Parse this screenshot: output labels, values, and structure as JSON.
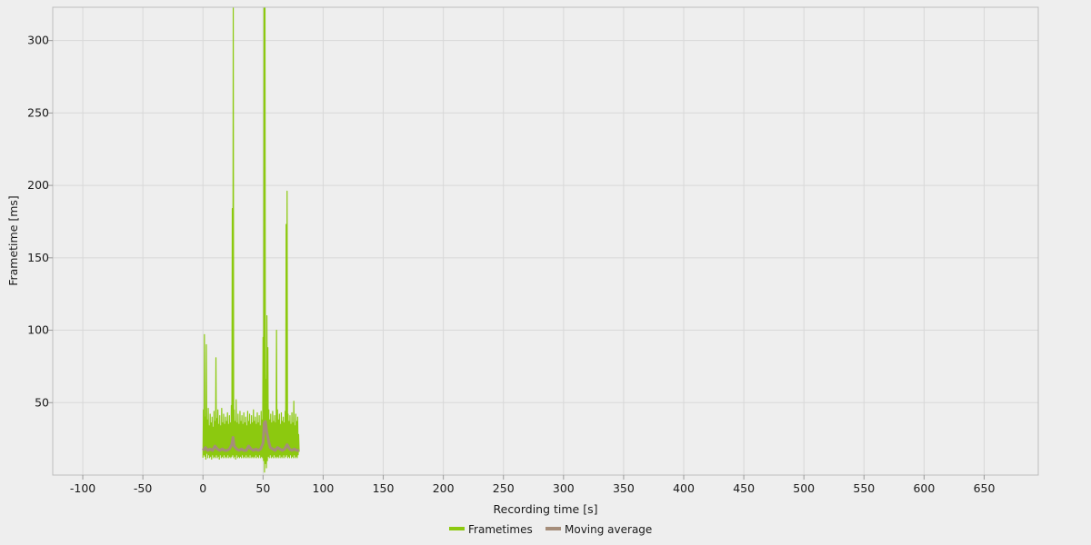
{
  "chart_data": {
    "type": "line",
    "title": "",
    "xlabel": "Recording time [s]",
    "ylabel": "Frametime [ms]",
    "xlim": [
      -125,
      695
    ],
    "ylim": [
      0,
      323
    ],
    "x_ticks": [
      -100,
      -50,
      0,
      50,
      100,
      150,
      200,
      250,
      300,
      350,
      400,
      450,
      500,
      550,
      600,
      650
    ],
    "x_tick_labels": [
      "-100",
      "-50",
      "0",
      "50",
      "100",
      "150",
      "200",
      "250",
      "300",
      "350",
      "400",
      "450",
      "500",
      "550",
      "600",
      "650"
    ],
    "y_ticks": [
      50,
      100,
      150,
      200,
      250,
      300
    ],
    "y_tick_labels": [
      "50",
      "100",
      "150",
      "200",
      "250",
      "300"
    ],
    "grid": true,
    "legend_position": "bottom-center",
    "series": [
      {
        "name": "Frametimes",
        "color": "#8cc90f",
        "points": [
          [
            0,
            12
          ],
          [
            0.4,
            45
          ],
          [
            0.8,
            14
          ],
          [
            1.2,
            97
          ],
          [
            1.6,
            13
          ],
          [
            2.0,
            40
          ],
          [
            2.4,
            11
          ],
          [
            2.8,
            90
          ],
          [
            3.2,
            15
          ],
          [
            3.6,
            38
          ],
          [
            4.0,
            12
          ],
          [
            4.4,
            46
          ],
          [
            4.8,
            14
          ],
          [
            5.2,
            34
          ],
          [
            5.6,
            12
          ],
          [
            6.0,
            42
          ],
          [
            6.4,
            13
          ],
          [
            6.8,
            36
          ],
          [
            7.2,
            11
          ],
          [
            7.6,
            40
          ],
          [
            8.0,
            14
          ],
          [
            8.4,
            33
          ],
          [
            8.8,
            12
          ],
          [
            9.2,
            44
          ],
          [
            9.6,
            13
          ],
          [
            10.0,
            37
          ],
          [
            10.4,
            12
          ],
          [
            10.8,
            81
          ],
          [
            11.2,
            14
          ],
          [
            11.6,
            39
          ],
          [
            12.0,
            12
          ],
          [
            12.4,
            45
          ],
          [
            12.8,
            13
          ],
          [
            13.2,
            35
          ],
          [
            13.6,
            11
          ],
          [
            14.0,
            41
          ],
          [
            14.4,
            14
          ],
          [
            14.8,
            34
          ],
          [
            15.2,
            12
          ],
          [
            15.6,
            46
          ],
          [
            16.0,
            13
          ],
          [
            16.4,
            36
          ],
          [
            16.8,
            12
          ],
          [
            17.2,
            42
          ],
          [
            17.6,
            14
          ],
          [
            18.0,
            35
          ],
          [
            18.4,
            12
          ],
          [
            18.8,
            40
          ],
          [
            19.2,
            13
          ],
          [
            19.6,
            37
          ],
          [
            20.0,
            12
          ],
          [
            20.4,
            43
          ],
          [
            20.8,
            14
          ],
          [
            21.2,
            35
          ],
          [
            21.6,
            12
          ],
          [
            22.0,
            41
          ],
          [
            22.4,
            13
          ],
          [
            22.8,
            36
          ],
          [
            23.2,
            12
          ],
          [
            23.6,
            48
          ],
          [
            24.0,
            13
          ],
          [
            24.4,
            184
          ],
          [
            24.8,
            14
          ],
          [
            25.2,
            323
          ],
          [
            25.6,
            12
          ],
          [
            26.0,
            45
          ],
          [
            26.4,
            13
          ],
          [
            26.8,
            37
          ],
          [
            27.2,
            11
          ],
          [
            27.6,
            52
          ],
          [
            28.0,
            14
          ],
          [
            28.4,
            36
          ],
          [
            28.8,
            12
          ],
          [
            29.2,
            42
          ],
          [
            29.6,
            13
          ],
          [
            30.0,
            35
          ],
          [
            30.4,
            12
          ],
          [
            30.8,
            44
          ],
          [
            31.2,
            13
          ],
          [
            31.6,
            37
          ],
          [
            32.0,
            12
          ],
          [
            32.4,
            41
          ],
          [
            32.8,
            14
          ],
          [
            33.2,
            35
          ],
          [
            33.6,
            12
          ],
          [
            34.0,
            43
          ],
          [
            34.4,
            13
          ],
          [
            34.8,
            36
          ],
          [
            35.2,
            12
          ],
          [
            35.6,
            40
          ],
          [
            36.0,
            14
          ],
          [
            36.4,
            34
          ],
          [
            36.8,
            12
          ],
          [
            37.2,
            44
          ],
          [
            37.6,
            13
          ],
          [
            38.0,
            37
          ],
          [
            38.4,
            12
          ],
          [
            38.8,
            42
          ],
          [
            39.2,
            14
          ],
          [
            39.6,
            35
          ],
          [
            40.0,
            12
          ],
          [
            40.4,
            41
          ],
          [
            40.8,
            13
          ],
          [
            41.2,
            36
          ],
          [
            41.6,
            12
          ],
          [
            42.0,
            45
          ],
          [
            42.4,
            13
          ],
          [
            42.8,
            37
          ],
          [
            43.2,
            12
          ],
          [
            43.6,
            40
          ],
          [
            44.0,
            14
          ],
          [
            44.4,
            35
          ],
          [
            44.8,
            12
          ],
          [
            45.2,
            43
          ],
          [
            45.6,
            13
          ],
          [
            46.0,
            36
          ],
          [
            46.4,
            12
          ],
          [
            46.8,
            41
          ],
          [
            47.2,
            14
          ],
          [
            47.6,
            34
          ],
          [
            48.0,
            12
          ],
          [
            48.4,
            44
          ],
          [
            48.8,
            13
          ],
          [
            49.2,
            38
          ],
          [
            49.6,
            12
          ],
          [
            50.0,
            95
          ],
          [
            50.4,
            10
          ],
          [
            50.8,
            323
          ],
          [
            51.2,
            2
          ],
          [
            51.6,
            323
          ],
          [
            52.0,
            8
          ],
          [
            52.4,
            66
          ],
          [
            52.8,
            5
          ],
          [
            53.2,
            110
          ],
          [
            53.6,
            10
          ],
          [
            54.0,
            88
          ],
          [
            54.4,
            13
          ],
          [
            54.8,
            45
          ],
          [
            55.2,
            12
          ],
          [
            55.6,
            38
          ],
          [
            56.0,
            14
          ],
          [
            56.4,
            42
          ],
          [
            56.8,
            12
          ],
          [
            57.2,
            36
          ],
          [
            57.6,
            13
          ],
          [
            58.0,
            44
          ],
          [
            58.4,
            12
          ],
          [
            58.8,
            37
          ],
          [
            59.2,
            14
          ],
          [
            59.6,
            41
          ],
          [
            60.0,
            12
          ],
          [
            60.4,
            36
          ],
          [
            60.8,
            13
          ],
          [
            61.2,
            100
          ],
          [
            61.6,
            12
          ],
          [
            62.0,
            45
          ],
          [
            62.4,
            13
          ],
          [
            62.8,
            38
          ],
          [
            63.2,
            12
          ],
          [
            63.6,
            42
          ],
          [
            64.0,
            14
          ],
          [
            64.4,
            35
          ],
          [
            64.8,
            12
          ],
          [
            65.2,
            43
          ],
          [
            65.6,
            13
          ],
          [
            66.0,
            37
          ],
          [
            66.4,
            12
          ],
          [
            66.8,
            40
          ],
          [
            67.2,
            14
          ],
          [
            67.6,
            36
          ],
          [
            68.0,
            12
          ],
          [
            68.4,
            44
          ],
          [
            68.8,
            13
          ],
          [
            69.2,
            173
          ],
          [
            69.6,
            14
          ],
          [
            70.0,
            196
          ],
          [
            70.4,
            12
          ],
          [
            70.8,
            42
          ],
          [
            71.2,
            13
          ],
          [
            71.6,
            37
          ],
          [
            72.0,
            12
          ],
          [
            72.4,
            41
          ],
          [
            72.8,
            14
          ],
          [
            73.2,
            35
          ],
          [
            73.6,
            12
          ],
          [
            74.0,
            43
          ],
          [
            74.4,
            13
          ],
          [
            74.8,
            36
          ],
          [
            75.2,
            12
          ],
          [
            75.6,
            51
          ],
          [
            76.0,
            14
          ],
          [
            76.4,
            34
          ],
          [
            76.8,
            12
          ],
          [
            77.2,
            42
          ],
          [
            77.6,
            13
          ],
          [
            78.0,
            37
          ],
          [
            78.4,
            12
          ],
          [
            78.8,
            40
          ],
          [
            79.2,
            14
          ],
          [
            79.6,
            28
          ],
          [
            80.0,
            16
          ]
        ]
      },
      {
        "name": "Moving average",
        "color": "#a58d7a",
        "points": [
          [
            0,
            17
          ],
          [
            2,
            19
          ],
          [
            4,
            17
          ],
          [
            6,
            18
          ],
          [
            8,
            17
          ],
          [
            10,
            20
          ],
          [
            12,
            18
          ],
          [
            14,
            17
          ],
          [
            16,
            18
          ],
          [
            18,
            17
          ],
          [
            20,
            17
          ],
          [
            22,
            18
          ],
          [
            24,
            21
          ],
          [
            25,
            26
          ],
          [
            26,
            20
          ],
          [
            28,
            18
          ],
          [
            30,
            17
          ],
          [
            32,
            18
          ],
          [
            34,
            17
          ],
          [
            36,
            17
          ],
          [
            38,
            20
          ],
          [
            40,
            18
          ],
          [
            42,
            17
          ],
          [
            44,
            18
          ],
          [
            46,
            17
          ],
          [
            48,
            18
          ],
          [
            50,
            22
          ],
          [
            51,
            36
          ],
          [
            52,
            37
          ],
          [
            53,
            30
          ],
          [
            54,
            26
          ],
          [
            55,
            22
          ],
          [
            56,
            19
          ],
          [
            58,
            18
          ],
          [
            60,
            17
          ],
          [
            62,
            19
          ],
          [
            64,
            18
          ],
          [
            66,
            17
          ],
          [
            68,
            18
          ],
          [
            70,
            21
          ],
          [
            72,
            18
          ],
          [
            74,
            17
          ],
          [
            76,
            18
          ],
          [
            78,
            17
          ],
          [
            80,
            17
          ]
        ]
      }
    ]
  }
}
